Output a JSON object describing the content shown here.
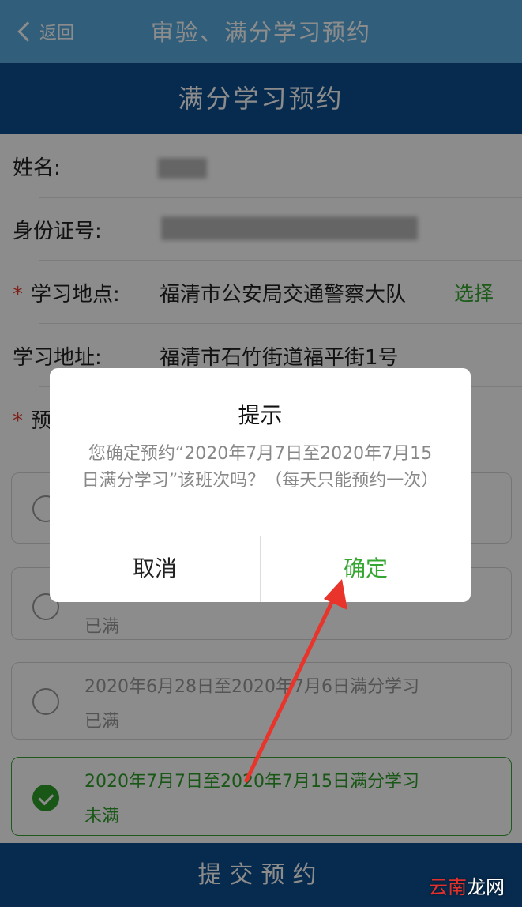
{
  "header": {
    "back_label": "返回",
    "title": "审验、满分学习预约"
  },
  "subheader": {
    "title": "满分学习预约"
  },
  "form": {
    "name_label": "姓名:",
    "id_label": "身份证号:",
    "location_label": "学习地点:",
    "location_value": "福清市公安局交通警察大队",
    "location_select": "选择",
    "address_label": "学习地址:",
    "address_value": "福清市石竹街道福平街1号",
    "required_mark": "*",
    "period_label": "预约"
  },
  "options": [
    {
      "title": "",
      "status": ""
    },
    {
      "title": "",
      "status": "已满"
    },
    {
      "title": "2020年6月28日至2020年7月6日满分学习",
      "status": "已满"
    },
    {
      "title": "2020年7月7日至2020年7月15日满分学习",
      "status": "未满"
    }
  ],
  "submit_label": "提交预约",
  "dialog": {
    "title": "提示",
    "message": "您确定预约“2020年7月7日至2020年7月15日满分学习”该班次吗？（每天只能预约一次）",
    "cancel_label": "取消",
    "confirm_label": "确定"
  },
  "watermark": {
    "part1": "云南",
    "part2": "龙网"
  },
  "colors": {
    "top_bar": "#5aaee0",
    "header_blue": "#0e4f8f",
    "accent_green": "#35a630",
    "required_red": "#e53b2c",
    "arrow_red": "#e8342a"
  },
  "icons": {
    "back": "chevron-left-icon",
    "radio_checked": "checkmark-icon"
  }
}
